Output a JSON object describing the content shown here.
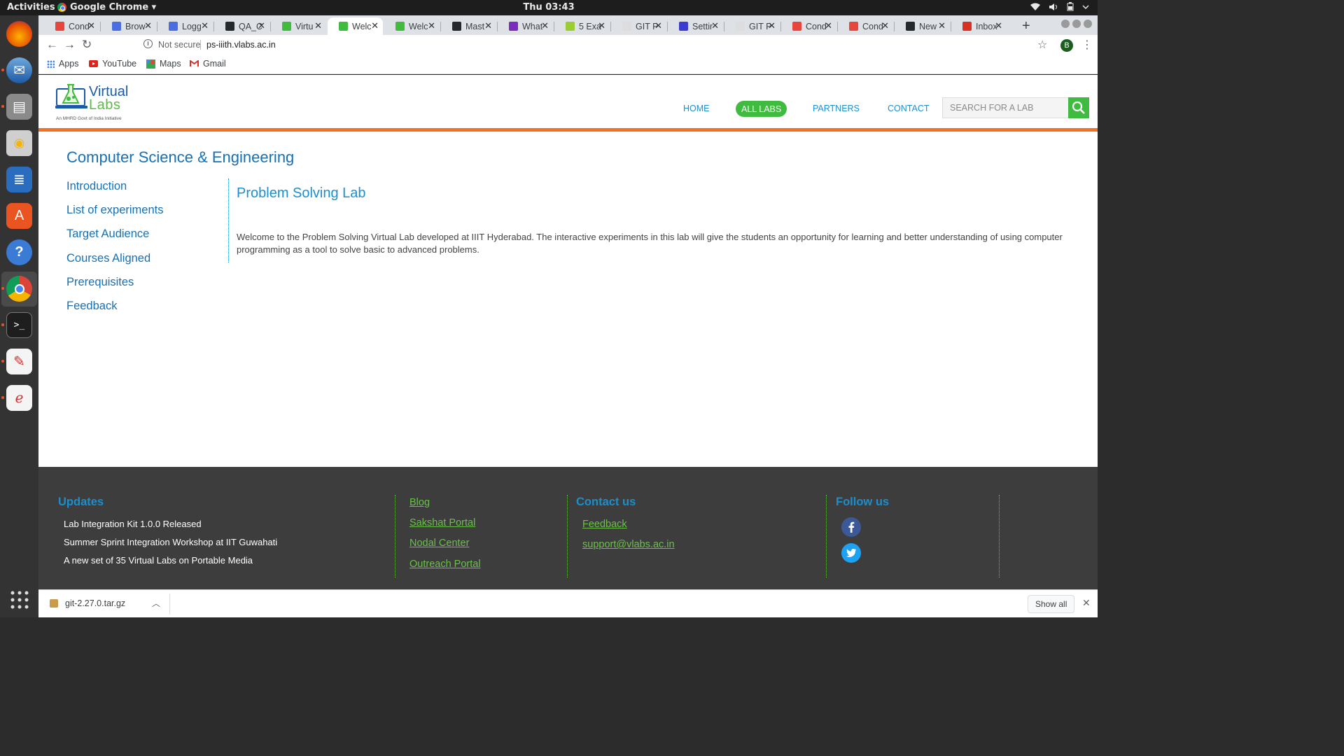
{
  "system": {
    "activities": "Activities",
    "app_name": "Google Chrome ▾",
    "clock": "Thu 03:43"
  },
  "browser": {
    "tabs": [
      {
        "label": "Cond",
        "color": "#e8453c"
      },
      {
        "label": "Brow",
        "color": "#4a6ee0"
      },
      {
        "label": "Logg",
        "color": "#4a6ee0"
      },
      {
        "label": "QA_C",
        "color": "#24292e"
      },
      {
        "label": "Virtu",
        "color": "#3fbb3f"
      },
      {
        "label": "Welc",
        "color": "#3fbb3f"
      },
      {
        "label": "Welc",
        "color": "#3fbb3f"
      },
      {
        "label": "Mast",
        "color": "#24292e"
      },
      {
        "label": "What",
        "color": "#7b2cbf"
      },
      {
        "label": "5 Exa",
        "color": "#9acd32"
      },
      {
        "label": "GIT P",
        "color": "#dddddd"
      },
      {
        "label": "Settir",
        "color": "#3b3bd1"
      },
      {
        "label": "GIT P",
        "color": "#dddddd"
      },
      {
        "label": "Cond",
        "color": "#e8453c"
      },
      {
        "label": "Cond",
        "color": "#e8453c"
      },
      {
        "label": "New",
        "color": "#24292e"
      },
      {
        "label": "Inbox",
        "color": "#d93025"
      }
    ],
    "active_tab_index": 5,
    "omnibox": {
      "security": "Not secure",
      "url": "ps-iiith.vlabs.ac.in"
    },
    "profile_initial": "B",
    "bookmarks": [
      {
        "label": "Apps",
        "icon": "apps-grid-icon"
      },
      {
        "label": "YouTube",
        "icon": "youtube-icon"
      },
      {
        "label": "Maps",
        "icon": "maps-icon"
      },
      {
        "label": "Gmail",
        "icon": "gmail-icon"
      }
    ]
  },
  "site": {
    "logo": {
      "line1": "Virtual",
      "line2": "Labs",
      "tagline": "An MHRD Govt of India Initiative"
    },
    "nav": {
      "home": "HOME",
      "all_labs": "ALL LABS",
      "partners": "PARTNERS",
      "contact": "CONTACT"
    },
    "search": {
      "placeholder": "SEARCH FOR A LAB"
    },
    "accent_orange": "#f36f21",
    "accent_green": "#3fbb3f",
    "accent_blue": "#1a8fce"
  },
  "main": {
    "department": "Computer Science & Engineering",
    "sidebar": [
      "Introduction",
      "List of experiments",
      "Target Audience",
      "Courses Aligned",
      "Prerequisites",
      "Feedback"
    ],
    "lab_title": "Problem Solving Lab",
    "lab_description": "Welcome to the Problem Solving Virtual Lab developed at IIIT Hyderabad. The interactive experiments in this lab will give the students an opportunity for learning and better understanding of using computer programming as a tool to solve basic to advanced problems."
  },
  "footer": {
    "updates": {
      "heading": "Updates",
      "items": [
        "Lab Integration Kit 1.0.0 Released",
        "Summer Sprint Integration Workshop at IIT Guwahati",
        "A new set of 35 Virtual Labs on Portable Media"
      ]
    },
    "links": [
      "Blog",
      "Sakshat Portal",
      "Nodal Center",
      "Outreach Portal"
    ],
    "contact": {
      "heading": "Contact us",
      "feedback": "Feedback",
      "email": "support@vlabs.ac.in"
    },
    "follow": {
      "heading": "Follow us",
      "facebook_icon": "facebook-icon",
      "twitter_icon": "twitter-icon"
    }
  },
  "downloads": {
    "file": "git-2.27.0.tar.gz",
    "show_all": "Show all"
  }
}
